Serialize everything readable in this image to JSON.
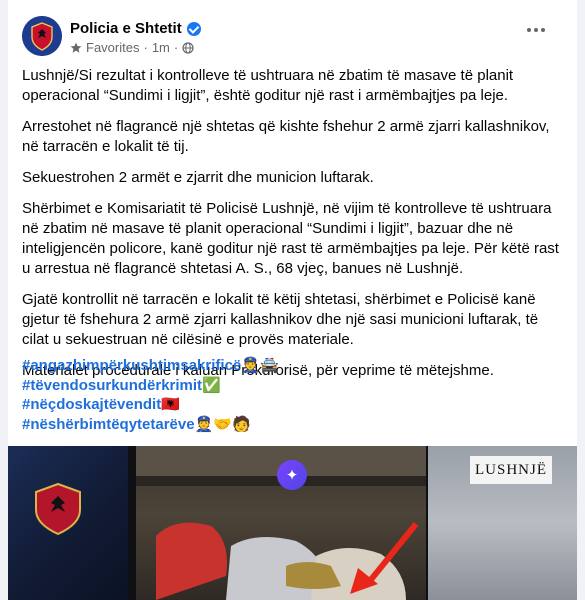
{
  "post": {
    "page_name": "Policia e Shtetit",
    "audience": "Favorites",
    "separator": "·",
    "time": "1m",
    "paragraphs": [
      "Lushnjë/Si rezultat i kontrolleve të ushtruara në zbatim të masave të planit operacional “Sundimi i ligjit”, është goditur një rast i armëmbajtjes pa leje.",
      "Arrestohet në flagrancë një shtetas që kishte fshehur 2 armë zjarri kallashnikov, në tarracën e lokalit të tij.",
      "Sekuestrohen 2 armët e zjarrit dhe municion luftarak.",
      "Shërbimet e Komisariatit të Policisë Lushnjë, në vijim të kontrolleve të ushtruara në zbatim në masave të planit operacional “Sundimi i ligjit”, bazuar dhe në inteligjencën policore, kanë goditur një rast të armëmbajtjes pa leje. Për këtë rast u arrestua në flagrancë shtetasi A. S., 68 vjeç, banues në Lushnjë.",
      "Gjatë kontrollit në tarracën e lokalit të këtij shtetasi, shërbimet e Policisë kanë gjetur të fshehura 2 armë zjarri kallashnikov dhe një sasi municioni luftarak, të cilat u sekuestruan në cilësinë e provës materiale.",
      "Materialet procedurale i  kaluan Prokurorisë, për veprime të mëtejshme."
    ],
    "hashtags": [
      {
        "text": "#angazhimpërkushtimsakrificë",
        "emoji": "👮🚔"
      },
      {
        "text": "#tëvendosurkundërkrimit",
        "emoji": "✅"
      },
      {
        "text": "#nëçdoskajtëvendit",
        "emoji": "🇦🇱"
      },
      {
        "text": "#nëshërbimtëqytetarëve",
        "emoji": "👮🤝🧑"
      }
    ]
  },
  "media": {
    "stamp_text": "LUSHNJË",
    "ai_icon": "✦"
  },
  "colors": {
    "hashtag": "#216fdb",
    "verified": "#1877f2",
    "arrow": "#e8261a"
  }
}
